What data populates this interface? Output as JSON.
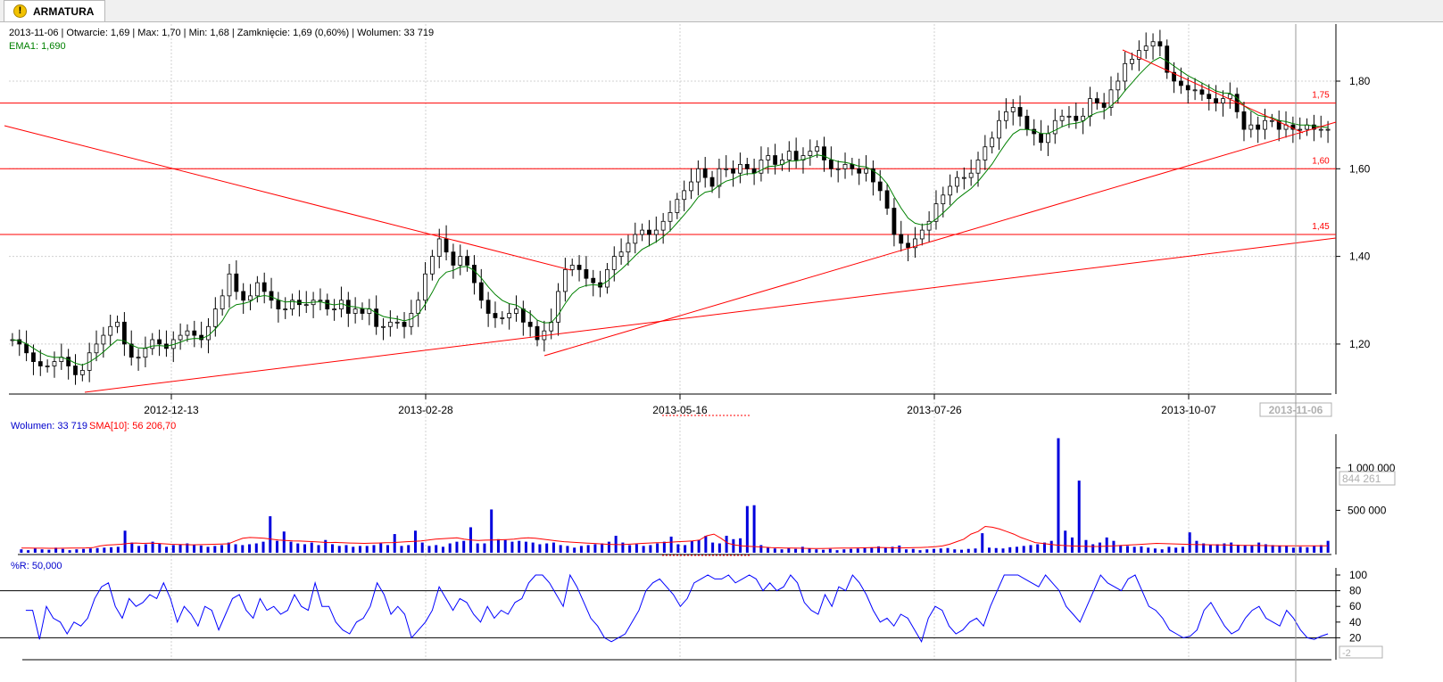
{
  "tab": {
    "label": "ARMATURA",
    "icon": "warning-icon"
  },
  "info": {
    "ohlc": "2013-11-06 | Otwarcie: 1,69 | Max: 1,70 | Min: 1,68 | Zamknięcie: 1,69 (0,60%)  | Wolumen: 33 719",
    "ema": "EMA1: 1,690"
  },
  "volume_info": {
    "vol": "Wolumen: 33 719",
    "sma": "SMA[10]: 56 206,70"
  },
  "wr_info": "%R: 50,000",
  "current_date_box": "2013-11-06",
  "current_volume_box": "844 261",
  "current_wr_box": "-2",
  "colors": {
    "up": "#ffffff",
    "down": "#000000",
    "ema": "#008000",
    "trend": "#ff0000",
    "volume": "#0000dd",
    "sma": "#ff0000",
    "wr": "#0000ff"
  },
  "chart_data": [
    {
      "type": "candlestick",
      "title": "",
      "x_ticks": [
        "2012-12-13",
        "2013-02-28",
        "2013-05-16",
        "2013-07-26",
        "2013-10-07"
      ],
      "y_ticks": [
        "1,20",
        "1,40",
        "1,60",
        "1,80"
      ],
      "ylim": [
        1.09,
        1.92
      ],
      "levels": [
        {
          "value": 1.75,
          "label": "1,75"
        },
        {
          "value": 1.6,
          "label": "1,60"
        },
        {
          "value": 1.45,
          "label": "1,45"
        }
      ],
      "close_series": [
        1.21,
        1.2,
        1.18,
        1.16,
        1.15,
        1.15,
        1.16,
        1.17,
        1.15,
        1.13,
        1.14,
        1.18,
        1.2,
        1.22,
        1.24,
        1.25,
        1.2,
        1.17,
        1.17,
        1.19,
        1.21,
        1.2,
        1.19,
        1.21,
        1.22,
        1.23,
        1.22,
        1.21,
        1.24,
        1.28,
        1.31,
        1.36,
        1.32,
        1.3,
        1.31,
        1.34,
        1.32,
        1.3,
        1.28,
        1.28,
        1.3,
        1.29,
        1.29,
        1.3,
        1.3,
        1.28,
        1.28,
        1.3,
        1.27,
        1.28,
        1.27,
        1.28,
        1.24,
        1.24,
        1.25,
        1.25,
        1.24,
        1.27,
        1.3,
        1.36,
        1.4,
        1.44,
        1.41,
        1.38,
        1.4,
        1.38,
        1.34,
        1.3,
        1.27,
        1.26,
        1.26,
        1.27,
        1.28,
        1.25,
        1.24,
        1.21,
        1.23,
        1.25,
        1.32,
        1.37,
        1.38,
        1.37,
        1.35,
        1.34,
        1.33,
        1.37,
        1.4,
        1.41,
        1.43,
        1.45,
        1.46,
        1.45,
        1.46,
        1.48,
        1.5,
        1.53,
        1.55,
        1.57,
        1.6,
        1.58,
        1.56,
        1.6,
        1.6,
        1.59,
        1.61,
        1.6,
        1.59,
        1.62,
        1.63,
        1.61,
        1.62,
        1.64,
        1.62,
        1.63,
        1.64,
        1.65,
        1.62,
        1.6,
        1.6,
        1.61,
        1.6,
        1.59,
        1.6,
        1.57,
        1.55,
        1.51,
        1.45,
        1.43,
        1.42,
        1.44,
        1.46,
        1.48,
        1.52,
        1.54,
        1.56,
        1.58,
        1.58,
        1.59,
        1.62,
        1.65,
        1.67,
        1.71,
        1.73,
        1.74,
        1.72,
        1.69,
        1.68,
        1.66,
        1.68,
        1.71,
        1.72,
        1.72,
        1.71,
        1.72,
        1.76,
        1.75,
        1.74,
        1.78,
        1.8,
        1.84,
        1.85,
        1.87,
        1.88,
        1.89,
        1.88,
        1.82,
        1.8,
        1.79,
        1.78,
        1.78,
        1.77,
        1.76,
        1.75,
        1.76,
        1.77,
        1.73,
        1.69,
        1.7,
        1.69,
        1.71,
        1.71,
        1.69,
        1.7,
        1.69,
        1.69,
        1.7,
        1.69,
        1.69,
        1.69
      ],
      "ema_label": "EMA1"
    },
    {
      "type": "bar",
      "title": "",
      "series": [
        {
          "name": "Wolumen",
          "color": "#0000dd"
        },
        {
          "name": "SMA[10]",
          "color": "#ff0000"
        }
      ],
      "y_ticks": [
        "500 000",
        "1 000 000"
      ],
      "ylim": [
        0,
        1450000
      ],
      "volumes": [
        40000,
        30000,
        50000,
        40000,
        35000,
        60000,
        45000,
        30000,
        40000,
        45000,
        50000,
        55000,
        60000,
        65000,
        70000,
        260000,
        120000,
        80000,
        100000,
        130000,
        110000,
        70000,
        90000,
        100000,
        110000,
        95000,
        85000,
        70000,
        80000,
        90000,
        120000,
        100000,
        90000,
        100000,
        110000,
        130000,
        430000,
        140000,
        250000,
        130000,
        110000,
        100000,
        120000,
        90000,
        150000,
        100000,
        80000,
        90000,
        70000,
        80000,
        80000,
        90000,
        110000,
        90000,
        220000,
        80000,
        90000,
        260000,
        120000,
        80000,
        90000,
        70000,
        110000,
        130000,
        140000,
        300000,
        110000,
        110000,
        510000,
        160000,
        150000,
        130000,
        140000,
        130000,
        120000,
        100000,
        110000,
        120000,
        90000,
        80000,
        60000,
        80000,
        90000,
        100000,
        110000,
        130000,
        200000,
        120000,
        90000,
        100000,
        80000,
        90000,
        110000,
        130000,
        190000,
        100000,
        90000,
        140000,
        150000,
        200000,
        120000,
        110000,
        200000,
        160000,
        170000,
        550000,
        560000,
        90000,
        60000,
        50000,
        40000,
        55000,
        45000,
        70000,
        50000,
        40000,
        35000,
        45000,
        30000,
        40000,
        45000,
        50000,
        55000,
        60000,
        75000,
        60000,
        70000,
        85000,
        40000,
        45000,
        30000,
        40000,
        45000,
        50000,
        55000,
        40000,
        35000,
        45000,
        50000,
        230000,
        60000,
        55000,
        50000,
        65000,
        70000,
        80000,
        90000,
        100000,
        120000,
        140000,
        1350000,
        260000,
        180000,
        850000,
        150000,
        100000,
        120000,
        180000,
        140000,
        90000,
        80000,
        70000,
        75000,
        60000,
        50000,
        40000,
        70000,
        60000,
        70000,
        240000,
        140000,
        110000,
        90000,
        100000,
        110000,
        120000,
        95000,
        90000,
        85000,
        120000,
        100000,
        90000,
        85000,
        80000,
        60000,
        70000,
        65000,
        80000,
        90000,
        140000
      ],
      "sma_series": [
        55000,
        55000,
        54000,
        54000,
        53000,
        53000,
        54000,
        55000,
        56000,
        57000,
        60000,
        80000,
        90000,
        95000,
        100000,
        110000,
        115000,
        110000,
        112000,
        110000,
        105000,
        100000,
        98000,
        96000,
        94000,
        96000,
        98000,
        100000,
        102000,
        105000,
        140000,
        170000,
        180000,
        175000,
        170000,
        160000,
        150000,
        145000,
        140000,
        138000,
        135000,
        130000,
        125000,
        120000,
        122000,
        118000,
        115000,
        112000,
        110000,
        112000,
        115000,
        118000,
        120000,
        125000,
        130000,
        135000,
        140000,
        150000,
        160000,
        165000,
        170000,
        175000,
        160000,
        150000,
        145000,
        148000,
        150000,
        152000,
        155000,
        160000,
        170000,
        175000,
        170000,
        160000,
        150000,
        140000,
        130000,
        125000,
        120000,
        115000,
        110000,
        105000,
        100000,
        98000,
        96000,
        100000,
        105000,
        110000,
        115000,
        118000,
        120000,
        125000,
        130000,
        135000,
        140000,
        150000,
        200000,
        220000,
        170000,
        110000,
        90000,
        80000,
        75000,
        70000,
        65000,
        60000,
        58000,
        56000,
        55000,
        54000,
        52000,
        50000,
        50000,
        52000,
        54000,
        55000,
        56000,
        57000,
        58000,
        60000,
        62000,
        60000,
        58000,
        57000,
        58000,
        60000,
        62000,
        65000,
        70000,
        80000,
        100000,
        130000,
        160000,
        220000,
        250000,
        310000,
        300000,
        280000,
        250000,
        220000,
        180000,
        150000,
        120000,
        110000,
        100000,
        90000,
        85000,
        80000,
        78000,
        76000,
        74000,
        75000,
        78000,
        80000,
        85000,
        90000,
        95000,
        100000,
        105000,
        110000,
        108000,
        105000,
        103000,
        100000,
        98000,
        96000,
        95000,
        94000,
        92000,
        90000,
        88000,
        87000,
        86000,
        85000,
        84000,
        83000,
        82000,
        82000,
        82000,
        82000,
        82000,
        82000,
        82000,
        82000
      ]
    },
    {
      "type": "line",
      "title": "",
      "series": [
        {
          "name": "%R",
          "color": "#0000ff"
        }
      ],
      "y_ticks": [
        "20",
        "40",
        "60",
        "80",
        "100"
      ],
      "ylim": [
        0,
        100
      ],
      "levels": [
        20,
        80
      ],
      "values": [
        55,
        55,
        18,
        60,
        45,
        40,
        25,
        40,
        35,
        45,
        70,
        85,
        90,
        60,
        45,
        70,
        60,
        65,
        75,
        70,
        90,
        70,
        40,
        60,
        50,
        35,
        60,
        55,
        30,
        50,
        70,
        75,
        55,
        45,
        70,
        55,
        60,
        50,
        55,
        75,
        60,
        55,
        90,
        60,
        60,
        40,
        30,
        25,
        40,
        45,
        60,
        90,
        75,
        50,
        60,
        50,
        20,
        30,
        40,
        55,
        85,
        70,
        55,
        70,
        65,
        50,
        40,
        60,
        45,
        55,
        50,
        65,
        70,
        90,
        100,
        100,
        90,
        75,
        60,
        100,
        85,
        65,
        45,
        35,
        20,
        15,
        20,
        25,
        40,
        55,
        80,
        90,
        95,
        85,
        75,
        60,
        70,
        90,
        95,
        100,
        95,
        95,
        100,
        90,
        95,
        100,
        95,
        80,
        90,
        80,
        85,
        100,
        90,
        65,
        55,
        50,
        75,
        60,
        85,
        80,
        100,
        90,
        75,
        55,
        40,
        45,
        35,
        50,
        45,
        30,
        15,
        45,
        60,
        55,
        35,
        25,
        30,
        40,
        45,
        35,
        60,
        80,
        100,
        100,
        100,
        95,
        90,
        85,
        100,
        90,
        80,
        60,
        50,
        40,
        60,
        80,
        100,
        90,
        85,
        80,
        95,
        100,
        80,
        60,
        55,
        45,
        30,
        25,
        20,
        22,
        30,
        55,
        65,
        50,
        35,
        25,
        30,
        45,
        55,
        60,
        45,
        40,
        35,
        55,
        45,
        30,
        20,
        18,
        22,
        25
      ]
    }
  ]
}
